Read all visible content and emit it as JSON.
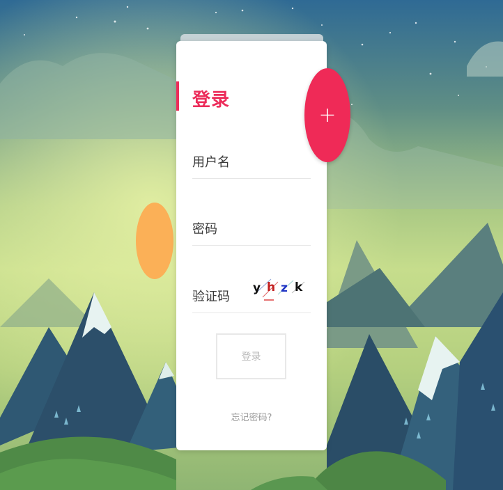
{
  "login_card": {
    "title": "登录",
    "username_label": "用户名",
    "password_label": "密码",
    "captcha_label": "验证码",
    "captcha_chars": [
      "y",
      "h",
      "z",
      "k"
    ],
    "submit_label": "登录",
    "forgot_label": "忘记密码?"
  },
  "fab": {
    "label": "+",
    "icon": "plus-icon"
  },
  "colors": {
    "accent": "#ec2c5a",
    "sun": "#fbb057",
    "sky_top": "#2f6a94",
    "glow": "#c8df8a"
  }
}
